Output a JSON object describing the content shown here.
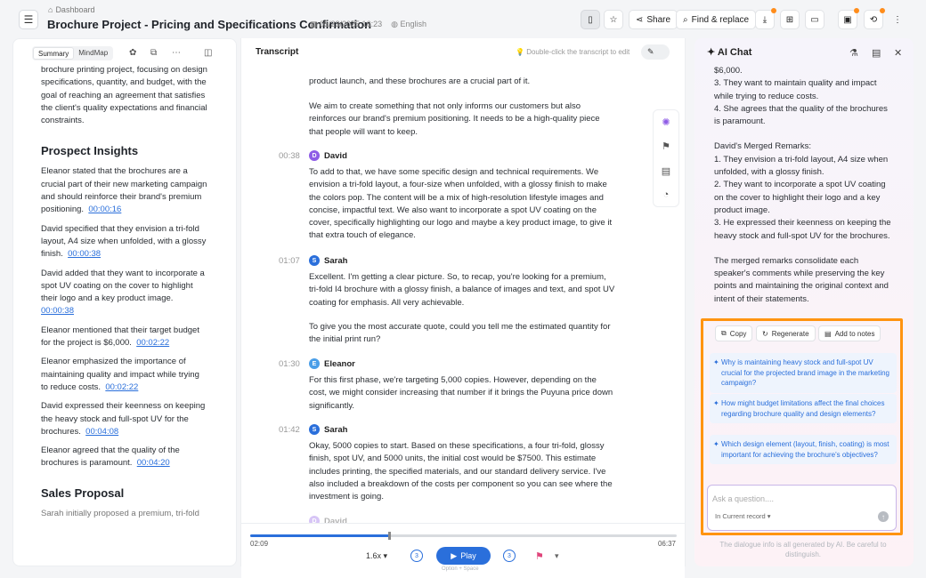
{
  "header": {
    "breadcrumb": "Dashboard",
    "title": "Brochure Project - Pricing and Specifications Confirmation",
    "datetime": "05/23/2025 16:23",
    "language": "English",
    "share_label": "Share",
    "find_replace_label": "Find & replace"
  },
  "summary": {
    "tabs": [
      "Summary",
      "MindMap"
    ],
    "intro": "brochure printing project, focusing on design specifications, quantity, and budget, with the goal of reaching an agreement that satisfies the client's quality expectations and financial constraints.",
    "insights_heading": "Prospect Insights",
    "insights": [
      {
        "text": "Eleanor stated that the brochures are a crucial part of their new marketing campaign and should reinforce their brand's premium positioning.",
        "time": "00:00:16"
      },
      {
        "text": "David specified that they envision a tri-fold layout, A4 size when unfolded, with a glossy finish.",
        "time": "00:00:38"
      },
      {
        "text": "David added that they want to incorporate a spot UV coating on the cover to highlight their logo and a key product image.",
        "time": "00:00:38"
      },
      {
        "text": "Eleanor mentioned that their target budget for the project is $6,000.",
        "time": "00:02:22"
      },
      {
        "text": "Eleanor emphasized the importance of maintaining quality and impact while trying to reduce costs.",
        "time": "00:02:22"
      },
      {
        "text": "David expressed their keenness on keeping the heavy stock and full-spot UV for the brochures.",
        "time": "00:04:08"
      },
      {
        "text": "Eleanor agreed that the quality of the brochures is paramount.",
        "time": "00:04:20"
      }
    ],
    "proposal_heading": "Sales Proposal",
    "proposal_text": "Sarah initially proposed a premium, tri-fold"
  },
  "transcript": {
    "heading": "Transcript",
    "hint": "Double-click the transcript to edit",
    "lines": [
      {
        "text": "product launch, and these brochures are a crucial part of it."
      },
      {
        "text": "We aim to create something that not only informs our customers but also reinforces our brand's premium positioning. It needs to be a high-quality piece that people will want to keep."
      }
    ],
    "entries": [
      {
        "time": "00:38",
        "speaker": "David",
        "initial": "D",
        "color": "#8e5ce6",
        "text": "To add to that, we have some specific design and technical requirements. We envision a tri-fold layout, a four-size when unfolded, with a glossy finish to make the colors pop. The content will be a mix of high-resolution lifestyle images and concise, impactful text. We also want to incorporate a spot UV coating on the cover, specifically highlighting our logo and maybe a key product image, to give it that extra touch of elegance."
      },
      {
        "time": "01:07",
        "speaker": "Sarah",
        "initial": "S",
        "color": "#2a6fdb",
        "text": "Excellent. I'm getting a clear picture. So, to recap, you're looking for a premium, tri-fold I4 brochure with a glossy finish, a balance of images and text, and spot UV coating for emphasis. All very achievable.",
        "text2": "To give you the most accurate quote, could you tell me the estimated quantity for the initial print run?"
      },
      {
        "time": "01:30",
        "speaker": "Eleanor",
        "initial": "E",
        "color": "#4a9ee8",
        "text": "For this first phase, we're targeting 5,000 copies. However, depending on the cost, we might consider increasing that number if it brings the Puyuna price down significantly."
      },
      {
        "time": "01:42",
        "speaker": "Sarah",
        "initial": "S",
        "color": "#2a6fdb",
        "text": "Okay, 5000 copies to start. Based on these specifications, a four tri-fold, glossy finish, spot UV, and 5000 units, the initial cost would be $7500. This estimate includes printing, the specified materials, and our standard delivery service. I've also included a breakdown of the costs per component so you can see where the investment is going."
      }
    ],
    "next_speaker": "David"
  },
  "player": {
    "current": "02:09",
    "total": "06:37",
    "progress_pct": 32.5,
    "speed": "1.6x",
    "play_label": "Play",
    "shortcut": "Option + Space",
    "skip_back": "3",
    "skip_fwd": "3"
  },
  "chat": {
    "heading": "AI Chat",
    "response": [
      "$6,000.",
      "3. They want to maintain quality and impact while trying to reduce costs.",
      "4. She agrees that the quality of the brochures is paramount.",
      "",
      "David's Merged Remarks:",
      "1. They envision a tri-fold layout, A4 size when unfolded, with a glossy finish.",
      "2. They want to incorporate a spot UV coating on the cover to highlight their logo and a key product image.",
      "3. He expressed their keenness on keeping the heavy stock and full-spot UV for the brochures.",
      "",
      "The merged remarks consolidate each speaker's comments while preserving the key points and maintaining the original context and intent of their statements."
    ],
    "copy_label": "Copy",
    "regenerate_label": "Regenerate",
    "add_notes_label": "Add to notes",
    "suggestions": [
      "Why is maintaining heavy stock and full-spot UV crucial for the projected brand image in the marketing campaign?",
      "How might budget limitations affect the final choices regarding brochure quality and design elements?",
      "Which design element (layout, finish, coating) is most important for achieving the brochure's objectives?"
    ],
    "input_placeholder": "Ask a question....",
    "scope": "In Current record",
    "disclaimer": "The dialogue info is all generated by AI. Be careful to distinguish."
  }
}
